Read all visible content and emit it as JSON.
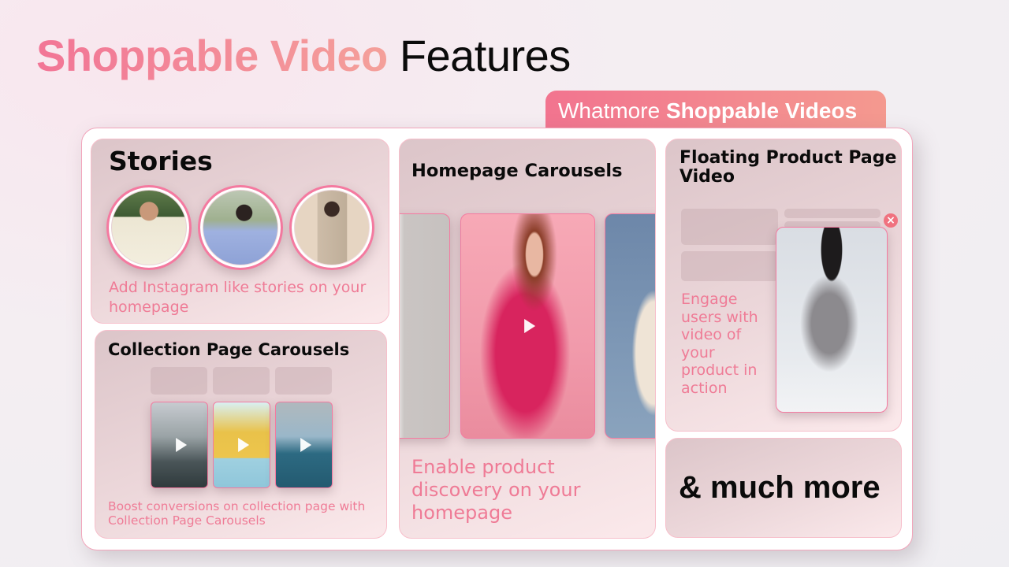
{
  "headline": {
    "highlight": "Shoppable Video",
    "rest": "Features",
    "gradient_colors": [
      "#f27596",
      "#f4a09a"
    ]
  },
  "brand_tab": {
    "light": "Whatmore",
    "bold": "Shoppable Videos",
    "gradient_colors": [
      "#f2748f",
      "#f4998f"
    ]
  },
  "cards": {
    "stories": {
      "title": "Stories",
      "description": "Add Instagram like stories on your homepage",
      "stories": [
        {
          "subject": "woman in cream blouse with palm backdrop"
        },
        {
          "subject": "woman in blue puff-sleeve dress outdoors"
        },
        {
          "subject": "woman in beige wrap blazer"
        }
      ]
    },
    "collection": {
      "title": "Collection Page Carousels",
      "description": "Boost conversions on collection page with Collection Page Carousels",
      "videos": [
        {
          "subject": "woman in city rooftop",
          "icon": "play-icon"
        },
        {
          "subject": "woman in yellow knit sweater",
          "icon": "play-icon"
        },
        {
          "subject": "woman in denim overalls and hat",
          "icon": "play-icon"
        }
      ]
    },
    "homepage": {
      "title": "Homepage Carousels",
      "description": "Enable product discovery on your homepage",
      "videos": [
        {
          "subject": "white suit"
        },
        {
          "subject": "woman in pink puff-sleeve dress",
          "icon": "play-icon"
        },
        {
          "subject": "woman in floral dress"
        }
      ]
    },
    "floating": {
      "title": "Floating Product Page Video",
      "description": "Engage users with video of your product in action",
      "close_icon": "close-icon",
      "video_subject": "woman in black hat and grey suit"
    },
    "more": {
      "title": "& much more"
    }
  },
  "colors": {
    "accent_pink": "#ef7b96",
    "border_pink": "#f47aa0"
  }
}
